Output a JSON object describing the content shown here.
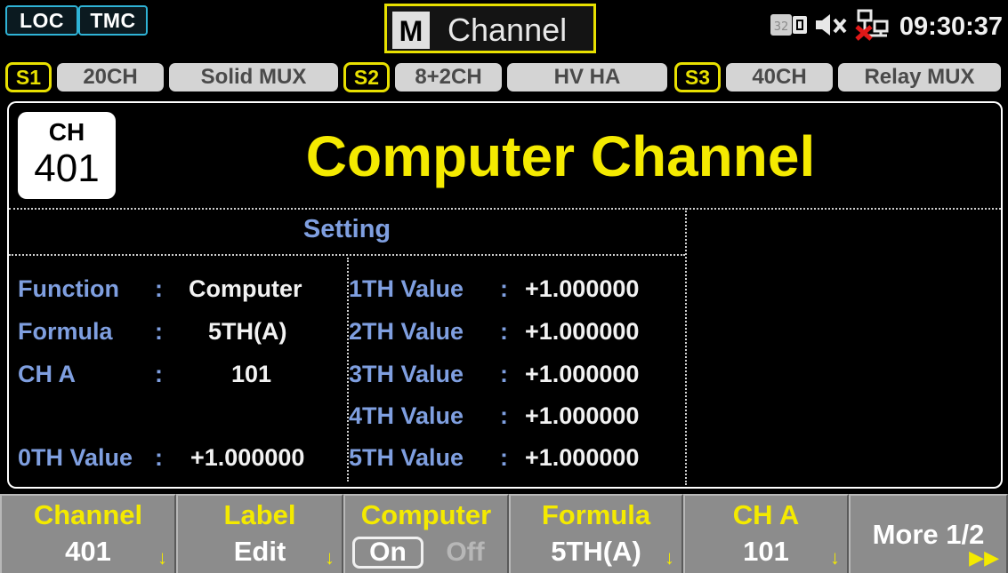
{
  "status_bar": {
    "loc": "LOC",
    "tmc": "TMC",
    "mode_letter": "M",
    "mode_title": "Channel",
    "card_label": "32",
    "clock": "09:30:37",
    "icons": [
      "memory-card-icon",
      "speaker-muted-icon",
      "network-disconnected-icon"
    ]
  },
  "slots": [
    {
      "num": "S1",
      "channels": "20CH",
      "type": "Solid MUX"
    },
    {
      "num": "S2",
      "channels": "8+2CH",
      "type": "HV  HA"
    },
    {
      "num": "S3",
      "channels": "40CH",
      "type": "Relay MUX"
    }
  ],
  "header": {
    "ch_label": "CH",
    "ch_number": "401",
    "title": "Computer Channel"
  },
  "setting": {
    "title": "Setting",
    "left": [
      {
        "label": "Function",
        "value": "Computer"
      },
      {
        "label": "Formula",
        "value": "5TH(A)"
      },
      {
        "label": "CH A",
        "value": "101"
      }
    ],
    "zeroth": {
      "label": "0TH Value",
      "value": "+1.000000"
    },
    "right": [
      {
        "label": "1TH Value",
        "value": "+1.000000"
      },
      {
        "label": "2TH Value",
        "value": "+1.000000"
      },
      {
        "label": "3TH Value",
        "value": "+1.000000"
      },
      {
        "label": "4TH Value",
        "value": "+1.000000"
      },
      {
        "label": "5TH Value",
        "value": "+1.000000"
      }
    ],
    "colon": ":"
  },
  "softkeys": {
    "channel": {
      "title": "Channel",
      "value": "401"
    },
    "label": {
      "title": "Label",
      "value": "Edit"
    },
    "computer": {
      "title": "Computer",
      "on": "On",
      "off": "Off",
      "selected": "On"
    },
    "formula": {
      "title": "Formula",
      "value": "5TH(A)"
    },
    "cha": {
      "title": "CH A",
      "value": "101"
    },
    "more": {
      "title": "More 1/2"
    }
  },
  "colors": {
    "accent_yellow": "#f4ea00",
    "label_blue": "#7f9fe0",
    "interface_cyan": "#2fb3d6",
    "softkey_gray": "#8c8c8c"
  }
}
